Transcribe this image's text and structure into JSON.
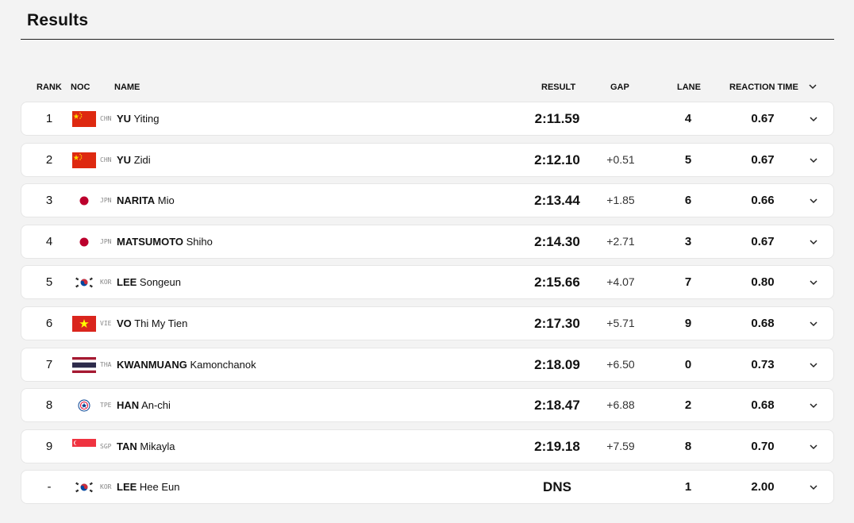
{
  "page": {
    "title": "Results"
  },
  "columns": {
    "rank": "RANK",
    "noc": "NOC",
    "name": "NAME",
    "result": "RESULT",
    "gap": "GAP",
    "lane": "LANE",
    "reaction_time": "REACTION TIME"
  },
  "rows": [
    {
      "rank": "1",
      "flag": "china-flag-icon",
      "noc": "CHN",
      "last": "YU",
      "first": "Yiting",
      "result": "2:11.59",
      "gap": "",
      "lane": "4",
      "reaction": "0.67"
    },
    {
      "rank": "2",
      "flag": "china-flag-icon",
      "noc": "CHN",
      "last": "YU",
      "first": "Zidi",
      "result": "2:12.10",
      "gap": "+0.51",
      "lane": "5",
      "reaction": "0.67"
    },
    {
      "rank": "3",
      "flag": "japan-flag-icon",
      "noc": "JPN",
      "last": "NARITA",
      "first": "Mio",
      "result": "2:13.44",
      "gap": "+1.85",
      "lane": "6",
      "reaction": "0.66"
    },
    {
      "rank": "4",
      "flag": "japan-flag-icon",
      "noc": "JPN",
      "last": "MATSUMOTO",
      "first": "Shiho",
      "result": "2:14.30",
      "gap": "+2.71",
      "lane": "3",
      "reaction": "0.67"
    },
    {
      "rank": "5",
      "flag": "korea-flag-icon",
      "noc": "KOR",
      "last": "LEE",
      "first": "Songeun",
      "result": "2:15.66",
      "gap": "+4.07",
      "lane": "7",
      "reaction": "0.80"
    },
    {
      "rank": "6",
      "flag": "vietnam-flag-icon",
      "noc": "VIE",
      "last": "VO",
      "first": "Thi My Tien",
      "result": "2:17.30",
      "gap": "+5.71",
      "lane": "9",
      "reaction": "0.68"
    },
    {
      "rank": "7",
      "flag": "thailand-flag-icon",
      "noc": "THA",
      "last": "KWANMUANG",
      "first": "Kamonchanok",
      "result": "2:18.09",
      "gap": "+6.50",
      "lane": "0",
      "reaction": "0.73"
    },
    {
      "rank": "8",
      "flag": "chinese-taipei-flag-icon",
      "noc": "TPE",
      "last": "HAN",
      "first": "An-chi",
      "result": "2:18.47",
      "gap": "+6.88",
      "lane": "2",
      "reaction": "0.68"
    },
    {
      "rank": "9",
      "flag": "singapore-flag-icon",
      "noc": "SGP",
      "last": "TAN",
      "first": "Mikayla",
      "result": "2:19.18",
      "gap": "+7.59",
      "lane": "8",
      "reaction": "0.70"
    },
    {
      "rank": "-",
      "flag": "korea-flag-icon",
      "noc": "KOR",
      "last": "LEE",
      "first": "Hee Eun",
      "result": "DNS",
      "gap": "",
      "lane": "1",
      "reaction": "2.00"
    }
  ],
  "colors": {
    "china": "#de2910",
    "china_star": "#ffde00",
    "japan": "#bc002d",
    "korea_red": "#cd2e3a",
    "korea_blue": "#0047a0",
    "vietnam": "#da251d",
    "thailand_red": "#a51931",
    "thailand_blue": "#2d2a4a",
    "taipei_blue": "#003d8f",
    "taipei_red": "#e4002b",
    "singapore": "#ef3340"
  }
}
